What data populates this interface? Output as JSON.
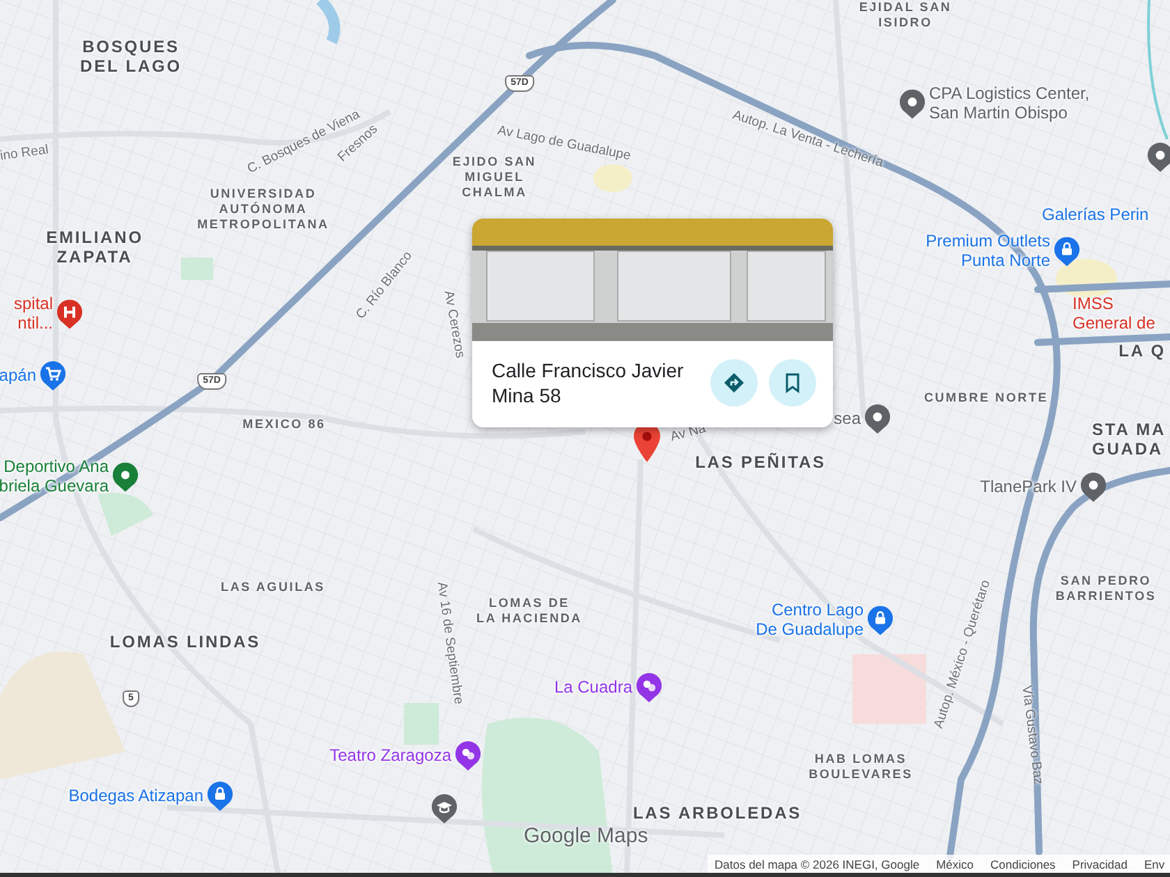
{
  "map": {
    "areas": [
      {
        "text": "BOSQUES\nDEL LAGO",
        "kind": "major"
      },
      {
        "text": "EJIDAL SAN\nISIDRO",
        "kind": "minor"
      },
      {
        "text": "EJIDO SAN\nMIGUEL\nCHALMA",
        "kind": "minor"
      },
      {
        "text": "UNIVERSIDAD\nAUTÓNOMA\nMETROPOLITANA",
        "kind": "minor"
      },
      {
        "text": "EMILIANO\nZAPATA",
        "kind": "major"
      },
      {
        "text": "MEXICO 86",
        "kind": "minor"
      },
      {
        "text": "LAS PEÑITAS",
        "kind": "major"
      },
      {
        "text": "CUMBRE NORTE",
        "kind": "minor"
      },
      {
        "text": "LA Q",
        "kind": "major"
      },
      {
        "text": "STA MA\nGUADA",
        "kind": "major"
      },
      {
        "text": "LAS AGUILAS",
        "kind": "minor"
      },
      {
        "text": "LOMAS LINDAS",
        "kind": "major"
      },
      {
        "text": "LOMAS DE\nLA HACIENDA",
        "kind": "minor"
      },
      {
        "text": "SAN PEDRO\nBARRIENTOS",
        "kind": "minor"
      },
      {
        "text": "HAB LOMAS\nBOULEVARES",
        "kind": "minor"
      },
      {
        "text": "LAS ARBOLEDAS",
        "kind": "major"
      }
    ],
    "streets": [
      {
        "text": "ino Real"
      },
      {
        "text": "C. Bosques de Viena"
      },
      {
        "text": "Fresnos"
      },
      {
        "text": "Av Lago de Guadalupe"
      },
      {
        "text": "Autop. La Venta - Lechería"
      },
      {
        "text": "C. Río Blanco"
      },
      {
        "text": "Av Cerezos"
      },
      {
        "text": "Av 16 de Septiembre"
      },
      {
        "text": "Autop. México - Querétaro"
      },
      {
        "text": "Vía Gustavo Baz"
      },
      {
        "text": "Av Na"
      }
    ],
    "shields": [
      {
        "text": "57D"
      },
      {
        "text": "57D"
      },
      {
        "text": "5"
      }
    ],
    "places": [
      {
        "text": "spital\nntil...",
        "kind": "hospital",
        "color": "#d93025"
      },
      {
        "text": "apán",
        "kind": "shop",
        "color": "#1a73e8"
      },
      {
        "text": "Deportivo Ana\nbriela Guevara",
        "kind": "park",
        "color": "#188038"
      },
      {
        "text": "CPA Logistics Center,\nSan Martin Obispo",
        "kind": "place",
        "color": "#5f6368"
      },
      {
        "kind": "place",
        "color": "#5f6368"
      },
      {
        "text": "Galerías Perin",
        "kind": "label",
        "color": "#1a73e8"
      },
      {
        "text": "Premium Outlets\nPunta Norte",
        "kind": "bag",
        "color": "#1a73e8"
      },
      {
        "text": "IMSS\nGeneral de",
        "kind": "label",
        "color": "#d93025"
      },
      {
        "text": "sea",
        "kind": "place",
        "color": "#5f6368"
      },
      {
        "text": "TlanePark IV",
        "kind": "place",
        "color": "#5f6368"
      },
      {
        "text": "Centro Lago\nDe Guadalupe",
        "kind": "bag",
        "color": "#1a73e8"
      },
      {
        "text": "La Cuadra",
        "kind": "theater",
        "color": "#9334e6"
      },
      {
        "text": "Teatro Zaragoza",
        "kind": "theater",
        "color": "#9334e6"
      },
      {
        "text": "Bodegas Atizapan",
        "kind": "bag",
        "color": "#1a73e8"
      },
      {
        "kind": "school",
        "color": "#5f6368"
      }
    ]
  },
  "place_card": {
    "title": "Calle Francisco Javier Mina 58",
    "actions": [
      {
        "kind": "directions"
      },
      {
        "kind": "save"
      }
    ]
  },
  "logo": "Google Maps",
  "footer": {
    "attribution": "Datos del mapa © 2026 INEGI, Google",
    "links": [
      "México",
      "Condiciones",
      "Privacidad",
      "Env"
    ]
  }
}
